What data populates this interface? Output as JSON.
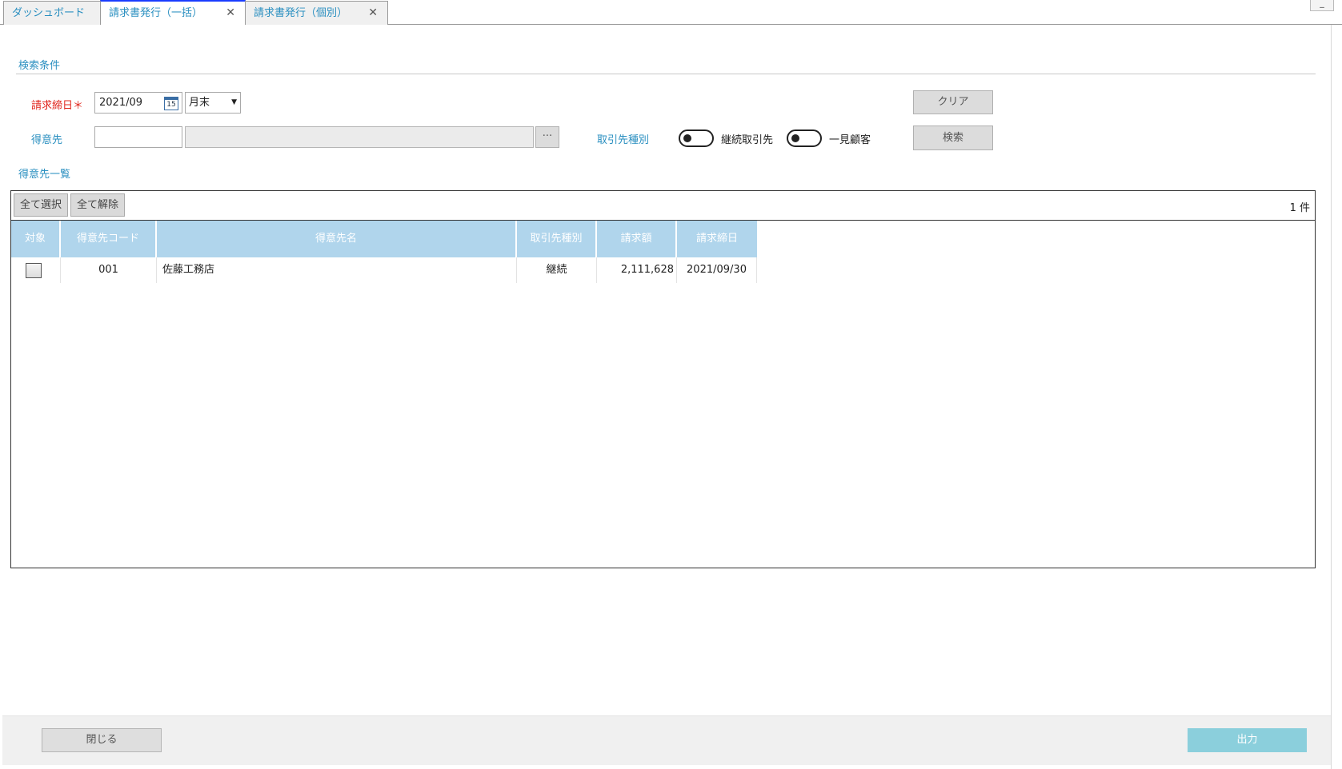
{
  "tabs": [
    {
      "label": "ダッシュボード"
    },
    {
      "label": "請求書発行（一括）"
    },
    {
      "label": "請求書発行（個別）"
    }
  ],
  "window": {
    "minimize_label": "_"
  },
  "search": {
    "section_title": "検索条件",
    "closing_date": {
      "label": "請求締日",
      "required_mark": "＊",
      "value": "2021/09",
      "calendar_text": "15",
      "cutoff_value": "月末"
    },
    "customer": {
      "label": "得意先",
      "code_value": "",
      "name_value": "",
      "browse_label": "···"
    },
    "partner_type": {
      "label": "取引先種別",
      "options": [
        "継続取引先",
        "一見顧客"
      ]
    },
    "clear_label": "クリア",
    "search_label": "検索"
  },
  "list": {
    "section_title": "得意先一覧",
    "select_all_label": "全て選択",
    "deselect_all_label": "全て解除",
    "count_text": "1 件",
    "columns": [
      "対象",
      "得意先コード",
      "得意先名",
      "取引先種別",
      "請求額",
      "請求締日"
    ],
    "rows": [
      {
        "checked": false,
        "code": "001",
        "name": "佐藤工務店",
        "type": "継続",
        "amount": "2,111,628",
        "date": "2021/09/30"
      }
    ]
  },
  "footer": {
    "close_label": "閉じる",
    "output_label": "出力"
  },
  "colors": {
    "accent": "#2a8fc0",
    "required": "#e0241b",
    "header_bg": "#b0d5ec",
    "output_button": "#8bcfdc",
    "active_tab_border": "#1a3cff"
  }
}
